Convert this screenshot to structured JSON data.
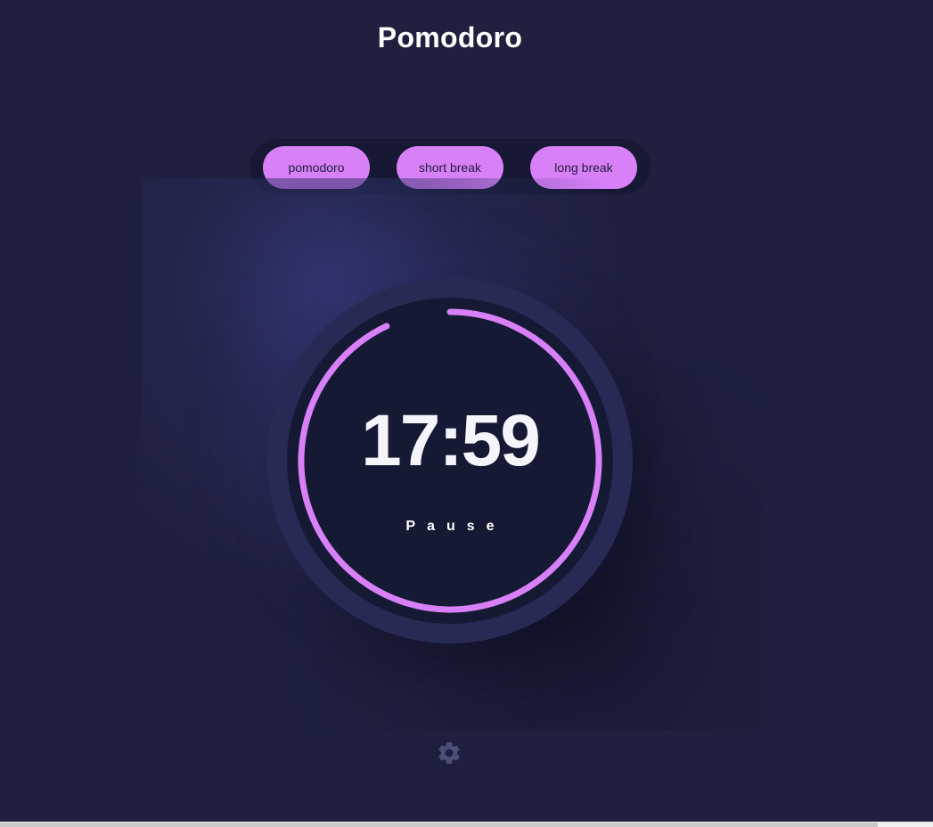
{
  "header": {
    "title": "Pomodoro"
  },
  "modes": [
    {
      "label": "pomodoro"
    },
    {
      "label": "short break"
    },
    {
      "label": "long break"
    }
  ],
  "timer": {
    "time": "17:59",
    "action_label": "Pause",
    "progress_remaining": 0.93
  },
  "icons": {
    "settings": "gear-icon"
  },
  "colors": {
    "background": "#1f2040",
    "accent": "#d880f8",
    "dial": "#161933",
    "dial_ring": "#282a56",
    "muted_icon": "#4b4f78",
    "text": "#ffffff"
  }
}
